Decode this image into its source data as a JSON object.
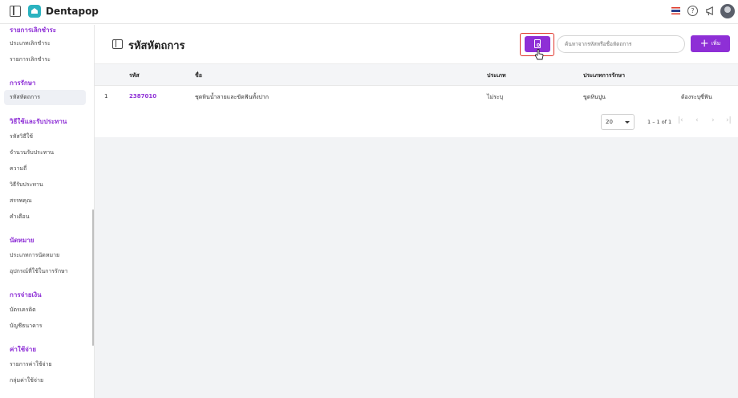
{
  "app": {
    "brand": "Dentapop"
  },
  "sidebar": {
    "sections": [
      {
        "title": "รายการเลิกชำระ",
        "items": [
          "ประเภทเลิกชำระ",
          "รายการเลิกชำระ"
        ]
      },
      {
        "title": "การรักษา",
        "items": [
          "รหัสหัตถการ"
        ]
      },
      {
        "title": "วิธีใช้และรับประทาน",
        "items": [
          "รหัสวิธีใช้",
          "จำนวนรับประทาน",
          "ความถี่",
          "วิธีรับประทาน",
          "สรรพคุณ",
          "คำเตือน"
        ]
      },
      {
        "title": "นัดหมาย",
        "items": [
          "ประเภทการนัดหมาย",
          "อุปกรณ์ที่ใช้ในการรักษา"
        ]
      },
      {
        "title": "การจ่ายเงิน",
        "items": [
          "บัตรเครดิต",
          "บัญชีธนาคาร"
        ]
      },
      {
        "title": "ค่าใช้จ่าย",
        "items": [
          "รายการค่าใช้จ่าย",
          "กลุ่มค่าใช้จ่าย"
        ]
      }
    ],
    "active_item": "รหัสหัตถการ"
  },
  "header": {
    "title": "รหัสหัตถการ",
    "search_placeholder": "ค้นหาจากรหัสหรือชื่อหัตถการ",
    "add_label": "เพิ่ม"
  },
  "table": {
    "columns": [
      "รหัส",
      "ชื่อ",
      "ประเภท",
      "ประเภทการรักษา"
    ],
    "rows": [
      {
        "index": "1",
        "code": "2387010",
        "name": "ชุดหินน้ำลายและขัดฟันทั้งปาก",
        "type": "ไม่ระบุ",
        "treatment_type": "ขูดหินปูน",
        "extra": "ต้องระบุซี่ฟัน"
      }
    ]
  },
  "pagination": {
    "page_size": "20",
    "range": "1 – 1 of 1"
  },
  "colors": {
    "accent": "#8e2fd6",
    "highlight_box": "#e0352b"
  }
}
